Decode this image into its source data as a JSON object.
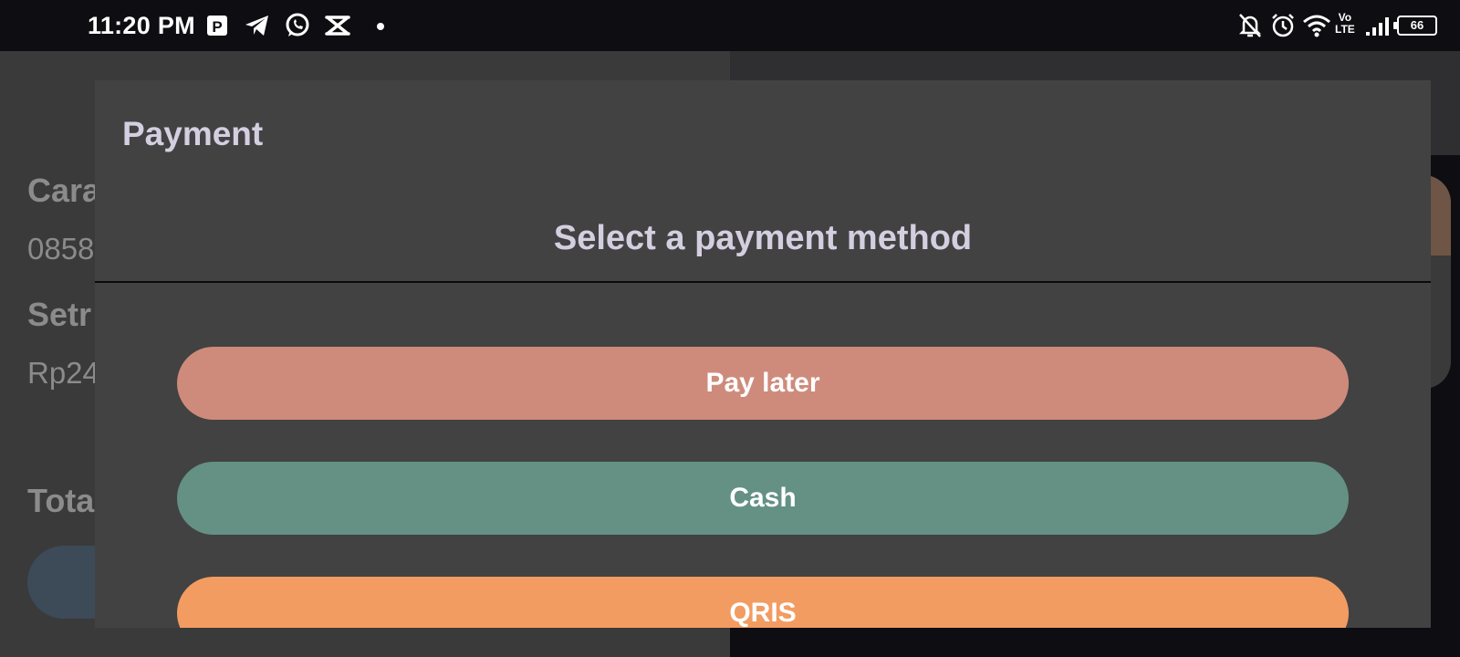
{
  "status_bar": {
    "time": "11:20 PM",
    "left_icons": [
      "parking-app-icon",
      "telegram-icon",
      "whatsapp-icon",
      "capcut-icon",
      "notification-dot"
    ],
    "right_icons": [
      "bell-off-icon",
      "alarm-icon",
      "wifi-icon",
      "volte-icon",
      "signal-icon",
      "battery-icon"
    ],
    "volte_text_top": "Vo",
    "volte_text_bottom": "LTE",
    "battery_level": "66"
  },
  "background": {
    "label_1": "Cara",
    "value_1": "0858",
    "label_2": "Setr",
    "value_2": "Rp24",
    "label_3": "Tota"
  },
  "dialog": {
    "title": "Payment",
    "subtitle": "Select a payment method",
    "buttons": [
      {
        "label": "Pay later",
        "color": "#ce8b7b"
      },
      {
        "label": "Cash",
        "color": "#649184"
      },
      {
        "label": "QRIS",
        "color": "#f29c62"
      }
    ]
  },
  "colors": {
    "dialog_bg": "#424242",
    "text_primary": "#d4cfe0",
    "statusbar_bg": "#0e0d12"
  }
}
